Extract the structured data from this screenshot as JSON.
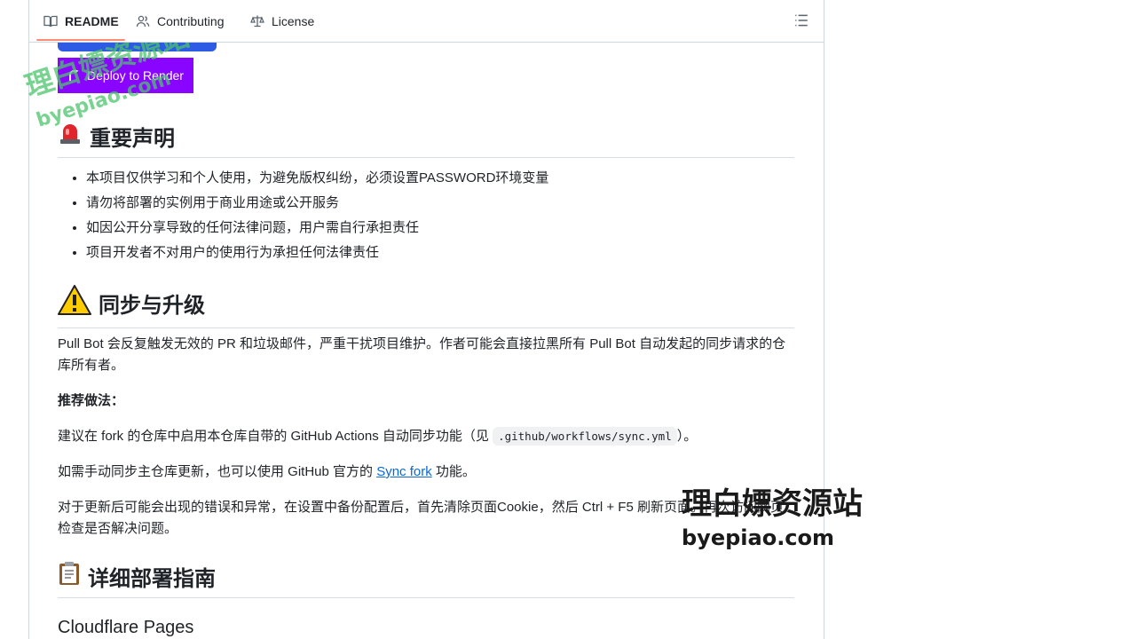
{
  "tabs": [
    {
      "label": "README",
      "icon": "book-icon",
      "active": true
    },
    {
      "label": "Contributing",
      "icon": "people-icon",
      "active": false
    },
    {
      "label": "License",
      "icon": "law-icon",
      "active": false
    }
  ],
  "deploy_button": {
    "label": "Deploy to Render"
  },
  "section_notice": {
    "title": "重要声明",
    "items": [
      "本项目仅供学习和个人使用，为避免版权纠纷，必须设置PASSWORD环境变量",
      "请勿将部署的实例用于商业用途或公开服务",
      "如因公开分享导致的任何法律问题，用户需自行承担责任",
      "项目开发者不对用户的使用行为承担任何法律责任"
    ]
  },
  "section_sync": {
    "title": "同步与升级",
    "para1": "Pull Bot 会反复触发无效的 PR 和垃圾邮件，严重干扰项目维护。作者可能会直接拉黑所有 Pull Bot 自动发起的同步请求的仓库所有者。",
    "recommend_label": "推荐做法：",
    "para2_prefix": "建议在 fork 的仓库中启用本仓库自带的 GitHub Actions 自动同步功能（见 ",
    "para2_code": ".github/workflows/sync.yml",
    "para2_suffix": "）。",
    "para3_prefix": "如需手动同步主仓库更新，也可以使用 GitHub 官方的 ",
    "para3_link": "Sync fork",
    "para3_suffix": " 功能。",
    "para4": "对于更新后可能会出现的错误和异常，在设置中备份配置后，首先清除页面Cookie，然后 Ctrl + F5 刷新页面。再次访问网页检查是否解决问题。"
  },
  "section_deploy": {
    "title": "详细部署指南",
    "subtitle": "Cloudflare Pages"
  },
  "watermarks": {
    "cn": "理白嫖资源站",
    "url": "byepiao.com"
  },
  "colors": {
    "deploy_bg": "#8a05ff",
    "link": "#0969da",
    "tab_underline": "#fd8c73"
  }
}
